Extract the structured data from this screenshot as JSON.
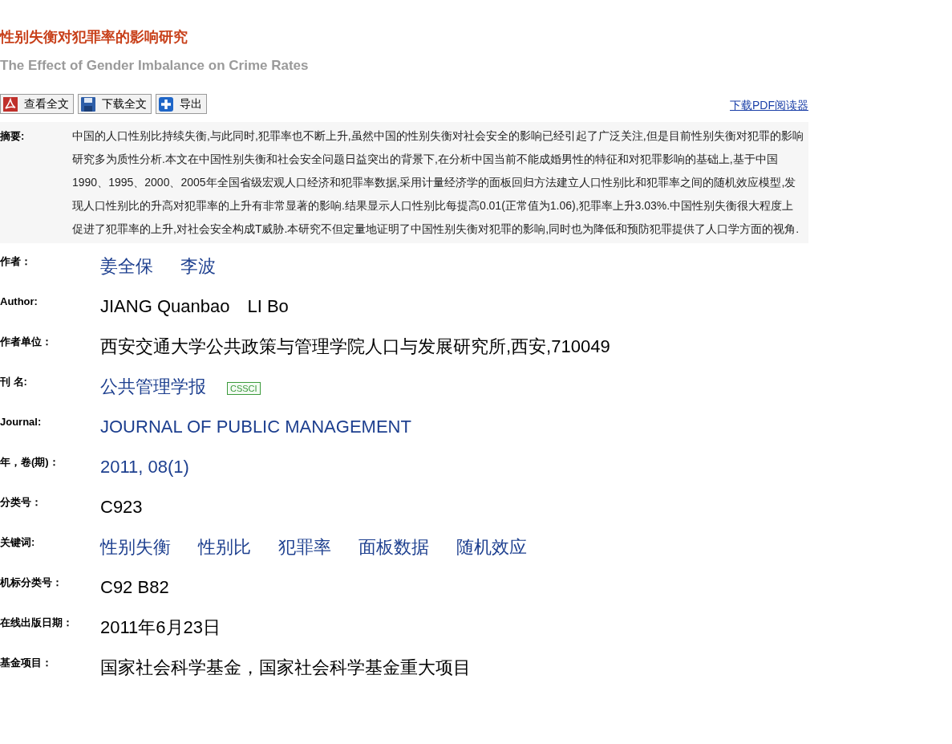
{
  "title": "性别失衡对犯罪率的影响研究",
  "subtitle": "The Effect of Gender Imbalance on Crime Rates",
  "toolbar": [
    {
      "kind": "pdf",
      "label": "查看全文"
    },
    {
      "kind": "save",
      "label": "下载全文"
    },
    {
      "kind": "plus",
      "label": "导出"
    }
  ],
  "reader_link": "下载PDF阅读器",
  "abstract": {
    "label": "摘要:",
    "text": "中国的人口性别比持续失衡,与此同时,犯罪率也不断上升,虽然中国的性别失衡对社会安全的影响已经引起了广泛关注,但是目前性别失衡对犯罪的影响研究多为质性分析.本文在中国性别失衡和社会安全问题日益突出的背景下,在分析中国当前不能成婚男性的特征和对犯罪影响的基础上,基于中国1990、1995、2000、2005年全国省级宏观人口经济和犯罪率数据,采用计量经济学的面板回归方法建立人口性别比和犯罪率之间的随机效应模型,发现人口性别比的升高对犯罪率的上升有非常显著的影响.结果显示人口性别比每提高0.01(正常值为1.06),犯罪率上升3.03%.中国性别失衡很大程度上促进了犯罪率的上升,对社会安全构成T威胁.本研究不但定量地证明了中国性别失衡对犯罪的影响,同时也为降低和预防犯罪提供了人口学方面的视角."
  },
  "fields": [
    {
      "label": "作者：",
      "kind": "links",
      "values": [
        "姜全保",
        "李波"
      ]
    },
    {
      "label": "Author:",
      "kind": "text",
      "values": [
        "JIANG Quanbao",
        "LI Bo"
      ]
    },
    {
      "label": "作者单位：",
      "kind": "text",
      "values": [
        "西安交通大学公共政策与管理学院人口与发展研究所,西安,710049"
      ]
    },
    {
      "label": "刊 名:",
      "kind": "links",
      "values": [
        "公共管理学报"
      ],
      "badge": "CSSCI"
    },
    {
      "label": "Journal:",
      "kind": "links",
      "values": [
        "JOURNAL OF PUBLIC MANAGEMENT"
      ]
    },
    {
      "label": "年，卷(期)：",
      "kind": "links",
      "values": [
        "2011, 08(1)"
      ]
    },
    {
      "label": "分类号：",
      "kind": "text",
      "values": [
        "C923"
      ]
    },
    {
      "label": "关键词:",
      "kind": "links",
      "values": [
        "性别失衡",
        "性别比",
        "犯罪率",
        "面板数据",
        "随机效应"
      ]
    },
    {
      "label": "机标分类号：",
      "kind": "text",
      "values": [
        "C92 B82"
      ]
    },
    {
      "label": "在线出版日期：",
      "kind": "text",
      "values": [
        "2011年6月23日"
      ]
    },
    {
      "label": "基金项目：",
      "kind": "text",
      "values": [
        "国家社会科学基金，国家社会科学基金重大项目"
      ]
    }
  ]
}
